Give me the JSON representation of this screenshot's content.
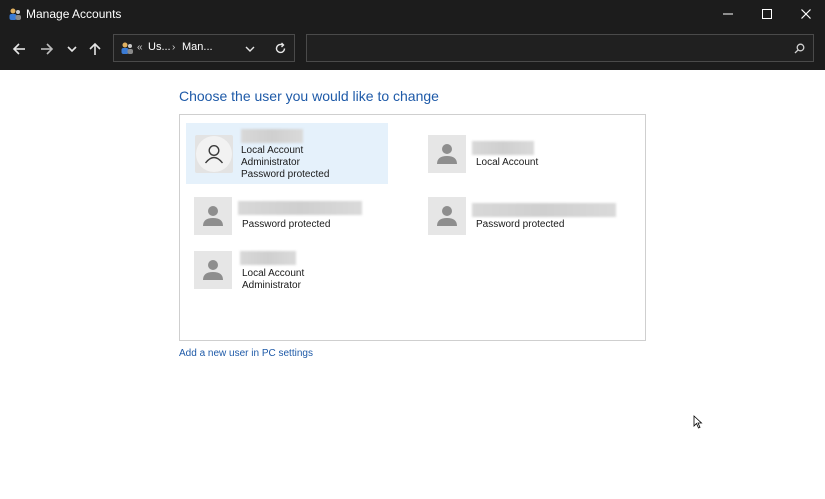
{
  "window": {
    "title": "Manage Accounts",
    "controls": {
      "minimize_icon": "minimize-icon",
      "maximize_icon": "maximize-icon",
      "close_icon": "close-icon"
    }
  },
  "navbar": {
    "address": {
      "sep": "«",
      "parts": [
        "Us...",
        "Man..."
      ],
      "arrow": "›"
    }
  },
  "main": {
    "heading": "Choose the user you would like to change",
    "accounts": [
      {
        "lines": [
          "Local Account",
          "Administrator",
          "Password protected"
        ],
        "selected": true
      },
      {
        "lines": [
          "Local Account"
        ],
        "selected": false
      },
      {
        "lines": [
          "Password protected"
        ],
        "selected": false
      },
      {
        "lines": [
          "Password protected"
        ],
        "selected": false
      },
      {
        "lines": [
          "Local Account",
          "Administrator"
        ],
        "selected": false
      }
    ],
    "add_user_link": "Add a new user in PC settings"
  },
  "colors": {
    "accent": "#1e5aa8",
    "titlebar": "#1c1c1c",
    "selection": "#e5f1fb"
  }
}
